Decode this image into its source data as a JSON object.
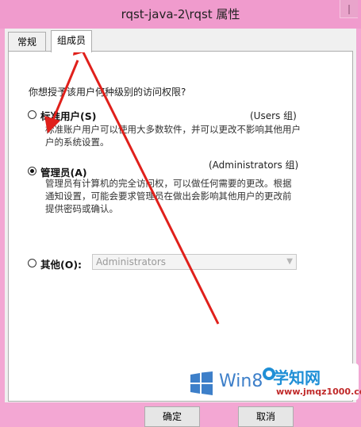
{
  "window": {
    "title": "rqst-java-2\\rqst 属性"
  },
  "tabs": [
    {
      "label": "常规"
    },
    {
      "label": "组成员"
    }
  ],
  "panel": {
    "question": "你想授予该用户何种级别的访问权限?",
    "options": [
      {
        "label": "标准用户(S)",
        "group": "(Users 组)",
        "desc": "标准账户用户可以使用大多数软件，并可以更改不影响其他用户\n户的系统设置。",
        "selected": false
      },
      {
        "label": "管理员(A)",
        "group": "(Administrators 组)",
        "desc": "管理员有计算机的完全访问权，可以做任何需要的更改。根据\n通知设置，可能会要求管理员在做出会影响其他用户的更改前\n提供密码或确认。",
        "selected": true
      },
      {
        "label": "其他(O):",
        "selected": false
      }
    ],
    "other_select": {
      "value": "Administrators"
    }
  },
  "buttons": {
    "ok": "确定",
    "cancel": "取消"
  },
  "watermark": {
    "win8": "Win8",
    "site_title": "学知网",
    "site_url": "www.jmqz1000.com"
  },
  "colors": {
    "titlebar": "#f09bcd",
    "annotation_arrow": "#e0201b",
    "win_blue": "#3d7fc9"
  }
}
